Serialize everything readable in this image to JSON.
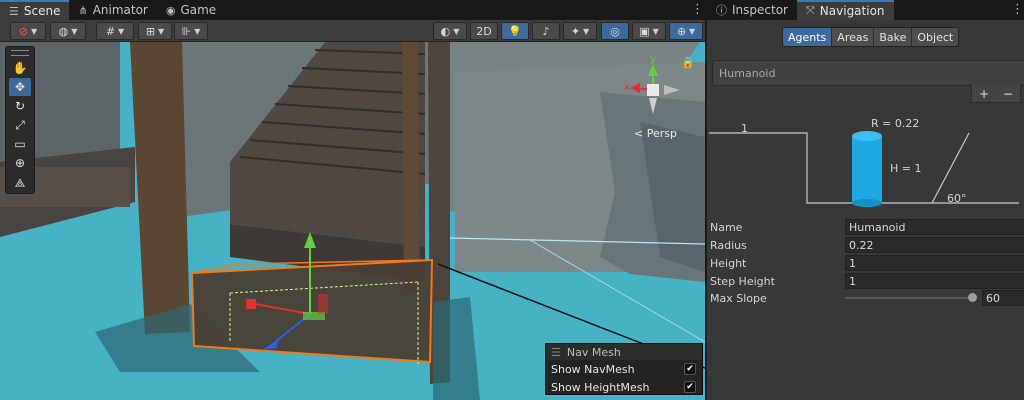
{
  "scene_tabs": [
    {
      "label": "Scene",
      "icon": "scene-icon"
    },
    {
      "label": "Animator",
      "icon": "animator-icon"
    },
    {
      "label": "Game",
      "icon": "game-icon"
    }
  ],
  "toolbar": {
    "mode_2d": "2D"
  },
  "gizmo": {
    "x_label": "x",
    "y_label": "y",
    "projection": "Persp"
  },
  "nav_overlay": {
    "title": "Nav Mesh",
    "rows": [
      {
        "label": "Show NavMesh",
        "checked": true
      },
      {
        "label": "Show HeightMesh",
        "checked": true
      }
    ]
  },
  "right_tabs": [
    {
      "label": "Inspector",
      "icon": "inspector-icon"
    },
    {
      "label": "Navigation",
      "icon": "navigation-icon"
    }
  ],
  "nav_tabs": [
    "Agents",
    "Areas",
    "Bake",
    "Object"
  ],
  "nav_active_tab": "Agents",
  "agent_list": {
    "selected": "Humanoid"
  },
  "list_buttons": {
    "add": "+",
    "remove": "−"
  },
  "agent_diagram": {
    "step_label": "1",
    "radius_label": "R = 0.22",
    "height_label": "H = 1",
    "slope_label": "60°",
    "cylinder_color": "#1ea7e1"
  },
  "agent_fields": [
    {
      "label": "Name",
      "value": "Humanoid"
    },
    {
      "label": "Radius",
      "value": "0.22"
    },
    {
      "label": "Height",
      "value": "1"
    },
    {
      "label": "Step Height",
      "value": "1"
    }
  ],
  "max_slope": {
    "label": "Max Slope",
    "value": "60",
    "fraction": 0.98
  },
  "colors": {
    "accent": "#3d6a9c",
    "water": "#47b4c6",
    "selection": "#f07a1a"
  }
}
